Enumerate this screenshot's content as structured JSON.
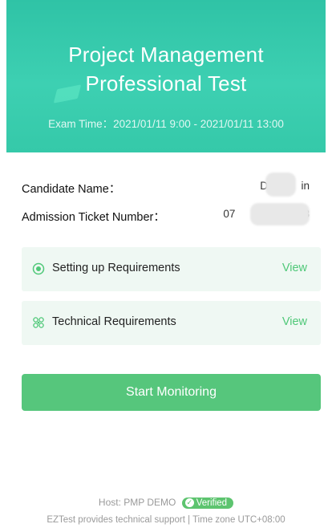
{
  "header": {
    "title_line1": "Project Management",
    "title_line2": "Professional Test",
    "exam_time": "Exam Time：2021/01/11 9:00 - 2021/01/11 13:00"
  },
  "candidate": {
    "name_label": "Candidate Name：",
    "name_value_visible_start": "D",
    "name_value_visible_end": "in",
    "ticket_label": "Admission Ticket Number：",
    "ticket_value_visible_start": "07",
    "ticket_value_visible_end": "98"
  },
  "requirements": [
    {
      "label": "Setting up Requirements",
      "action": "View",
      "icon": "radio-target-icon"
    },
    {
      "label": "Technical Requirements",
      "action": "View",
      "icon": "gear-network-icon"
    }
  ],
  "start_button": "Start Monitoring",
  "footer": {
    "host_text": "Host: PMP DEMO",
    "verified_label": "Verified",
    "support_text": "EZTest provides technical support | Time zone  UTC+08:00"
  },
  "colors": {
    "header": "#35c9a9",
    "accent_green": "#56c67c",
    "card_bg": "#eff8f3"
  }
}
